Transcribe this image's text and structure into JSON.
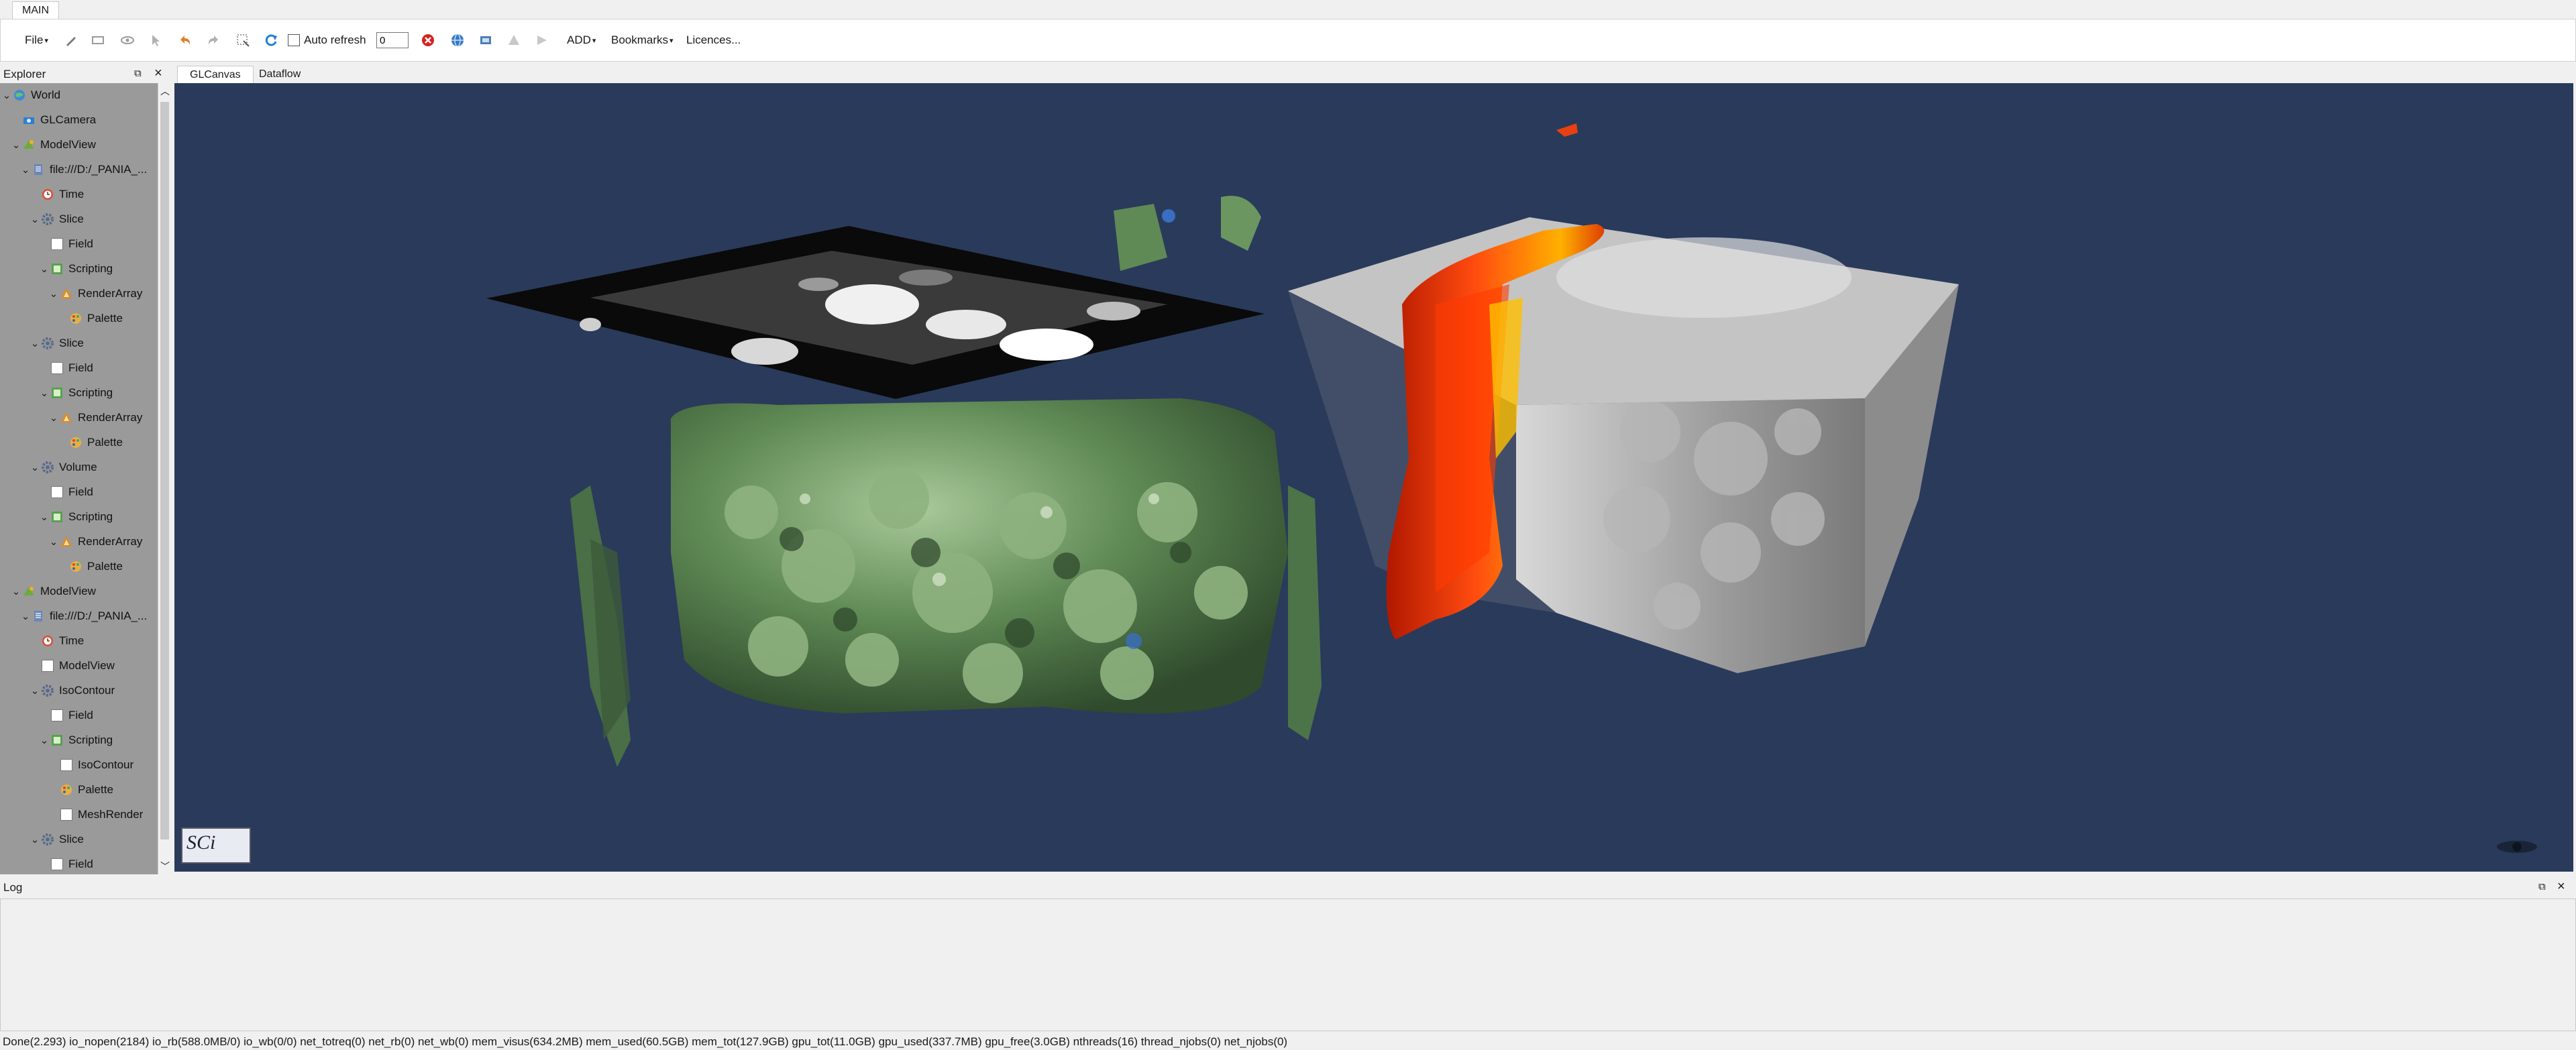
{
  "ribbon": {
    "tab_main": "MAIN"
  },
  "toolbar": {
    "file_menu": "File",
    "auto_refresh_label": "Auto refresh",
    "refresh_value": "0",
    "add_menu": "ADD",
    "bookmarks_menu": "Bookmarks",
    "licences_link": "Licences...",
    "icon_names": [
      "edit-icon",
      "select-icon",
      "eye-icon",
      "cursor-icon",
      "undo-icon",
      "redo-icon",
      "zoom-select-icon",
      "refresh-icon",
      "stop-icon",
      "globe-icon",
      "export-icon",
      "triangle-icon",
      "arrow-icon"
    ]
  },
  "explorer": {
    "title": "Explorer",
    "items": [
      {
        "label": "World",
        "icon": "world-icon",
        "expander": "v"
      },
      {
        "label": "GLCamera",
        "icon": "camera-icon",
        "expander": ""
      },
      {
        "label": "ModelView",
        "icon": "modelview-icon",
        "expander": "v"
      },
      {
        "label": "file:///D:/_PANIA_...",
        "icon": "file-icon",
        "expander": "v"
      },
      {
        "label": "Time",
        "icon": "clock-icon",
        "expander": ""
      },
      {
        "label": "Slice",
        "icon": "gear-icon",
        "expander": "v"
      },
      {
        "label": "Field",
        "icon": "field-icon",
        "expander": ""
      },
      {
        "label": "Scripting",
        "icon": "script-icon",
        "expander": "v"
      },
      {
        "label": "RenderArray",
        "icon": "render-icon",
        "expander": "v"
      },
      {
        "label": "Palette",
        "icon": "palette-icon",
        "expander": ""
      },
      {
        "label": "Slice",
        "icon": "gear-icon",
        "expander": "v"
      },
      {
        "label": "Field",
        "icon": "field-icon",
        "expander": ""
      },
      {
        "label": "Scripting",
        "icon": "script-icon",
        "expander": "v"
      },
      {
        "label": "RenderArray",
        "icon": "render-icon",
        "expander": "v"
      },
      {
        "label": "Palette",
        "icon": "palette-icon",
        "expander": ""
      },
      {
        "label": "Volume",
        "icon": "gear-icon",
        "expander": "v"
      },
      {
        "label": "Field",
        "icon": "field-icon",
        "expander": ""
      },
      {
        "label": "Scripting",
        "icon": "script-icon",
        "expander": "v"
      },
      {
        "label": "RenderArray",
        "icon": "render-icon",
        "expander": "v"
      },
      {
        "label": "Palette",
        "icon": "palette-icon",
        "expander": ""
      },
      {
        "label": "ModelView",
        "icon": "modelview-icon",
        "expander": "v"
      },
      {
        "label": "file:///D:/_PANIA_...",
        "icon": "file-icon",
        "expander": "v"
      },
      {
        "label": "Time",
        "icon": "clock-icon",
        "expander": ""
      },
      {
        "label": "ModelView",
        "icon": "field-icon",
        "expander": ""
      },
      {
        "label": "IsoContour",
        "icon": "gear-icon",
        "expander": "v"
      },
      {
        "label": "Field",
        "icon": "field-icon",
        "expander": ""
      },
      {
        "label": "Scripting",
        "icon": "script-icon",
        "expander": "v"
      },
      {
        "label": "IsoContour",
        "icon": "field-icon",
        "expander": ""
      },
      {
        "label": "Palette",
        "icon": "palette-icon",
        "expander": ""
      },
      {
        "label": "MeshRender",
        "icon": "field-icon",
        "expander": ""
      },
      {
        "label": "Slice",
        "icon": "gear-icon",
        "expander": "v"
      },
      {
        "label": "Field",
        "icon": "field-icon",
        "expander": ""
      }
    ]
  },
  "canvas": {
    "tabs": [
      "GLCanvas",
      "Dataflow"
    ],
    "background_color": "#2a3a5b",
    "logo_text": "SCi"
  },
  "log": {
    "title": "Log"
  },
  "status": {
    "text": "Done(2.293) io_nopen(2184) io_rb(588.0MB/0) io_wb(0/0) net_totreq(0) net_rb(0) net_wb(0) mem_visus(634.2MB) mem_used(60.5GB) mem_tot(127.9GB) gpu_tot(11.0GB) gpu_used(337.7MB) gpu_free(3.0GB) nthreads(16) thread_njobs(0) net_njobs(0)"
  }
}
